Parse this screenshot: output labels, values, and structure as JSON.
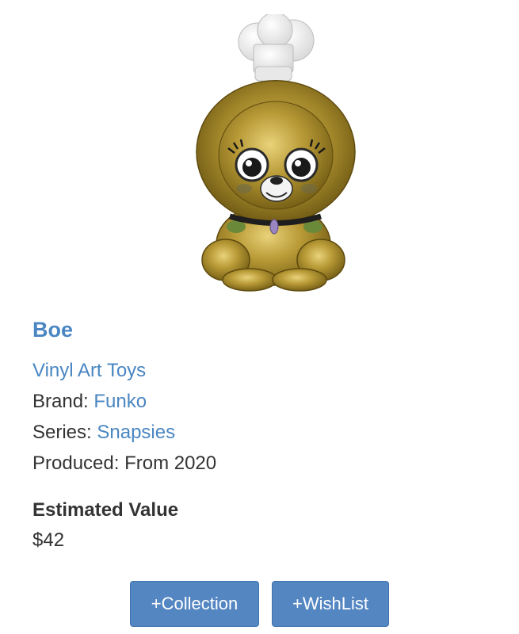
{
  "item": {
    "image_alt": "Boe golden lion Snapsies figure wearing a chef hat",
    "name": "Boe",
    "category": "Vinyl Art Toys",
    "brand_label": "Brand: ",
    "brand": "Funko",
    "series_label": "Series: ",
    "series": "Snapsies",
    "produced": "Produced: From 2020"
  },
  "value": {
    "heading": "Estimated Value",
    "amount": "$42"
  },
  "actions": {
    "collection_label": "+Collection",
    "wishlist_label": "+WishList"
  },
  "colors": {
    "link": "#4a86c2",
    "button": "#5486c2",
    "gold": "#b08f2c"
  }
}
